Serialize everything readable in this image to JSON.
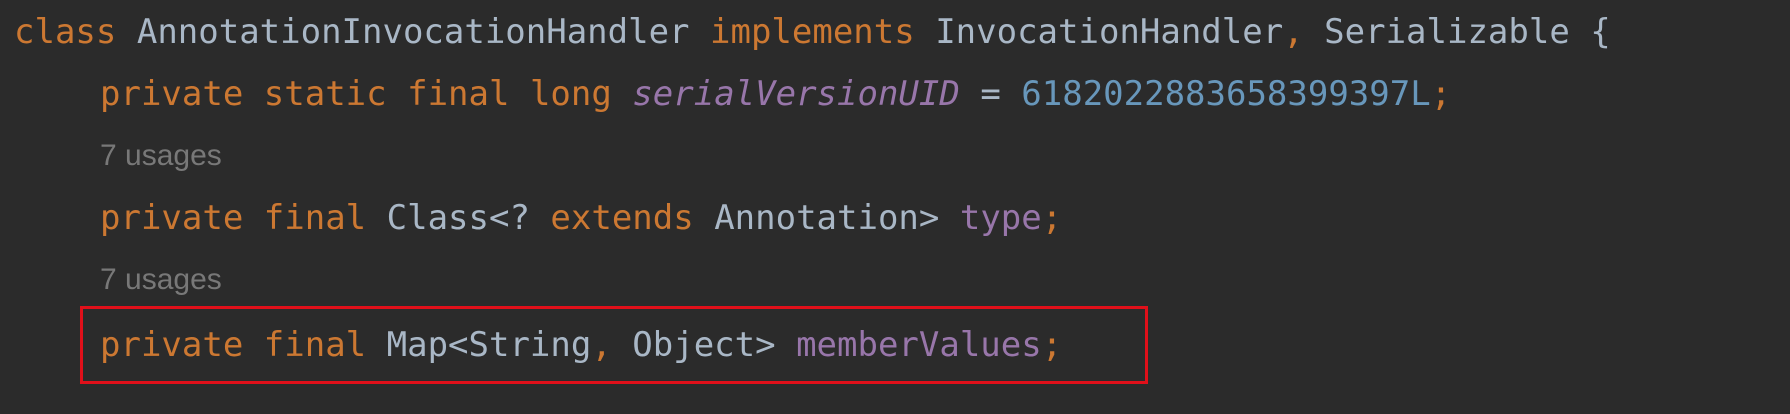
{
  "line1": {
    "kw_class": "class",
    "class_name": "AnnotationInvocationHandler",
    "kw_implements": "implements",
    "iface1": "InvocationHandler",
    "comma": ",",
    "iface2": "Serializable",
    "brace": "{"
  },
  "line2": {
    "kw_private": "private",
    "kw_static": "static",
    "kw_final": "final",
    "kw_long": "long",
    "field": "serialVersionUID",
    "eq": "=",
    "value": "6182022883658399397L",
    "semi": ";"
  },
  "hint1": "7 usages",
  "line3": {
    "kw_private": "private",
    "kw_final": "final",
    "type_start": "Class<?",
    "kw_extends": "extends",
    "type_end": "Annotation>",
    "field": "type",
    "semi": ";"
  },
  "hint2": "7 usages",
  "line4": {
    "kw_private": "private",
    "kw_final": "final",
    "type_start": "Map<String",
    "comma": ",",
    "type_end": "Object>",
    "field": "memberValues",
    "semi": ";"
  },
  "colors": {
    "background": "#2b2b2b",
    "keyword": "#cc7832",
    "identifier": "#a9b7c6",
    "field": "#9876aa",
    "number": "#6897bb",
    "hint": "#787878",
    "highlight_box": "#e0101a"
  }
}
